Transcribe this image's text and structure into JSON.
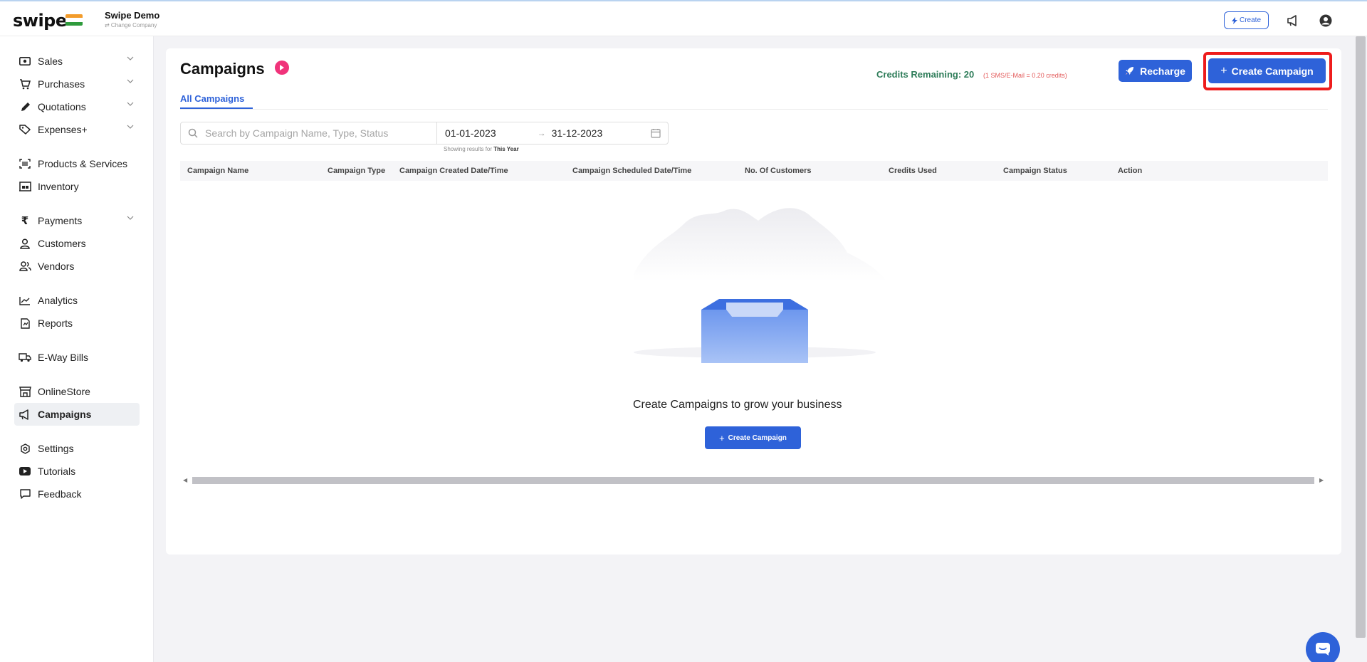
{
  "header": {
    "logo": "swipe",
    "company_name": "Swipe Demo",
    "change_company": "⇄ Change Company",
    "create_label": "Create"
  },
  "sidebar": {
    "items": [
      {
        "label": "Sales",
        "icon": "cash-icon",
        "has_chevron": true
      },
      {
        "label": "Purchases",
        "icon": "cart-icon",
        "has_chevron": true
      },
      {
        "label": "Quotations",
        "icon": "pen-icon",
        "has_chevron": true
      },
      {
        "label": "Expenses+",
        "icon": "tag-icon",
        "has_chevron": true
      },
      {
        "label": "Products & Services",
        "icon": "barcode-icon"
      },
      {
        "label": "Inventory",
        "icon": "warehouse-icon"
      },
      {
        "label": "Payments",
        "icon": "rupee-icon",
        "has_chevron": true
      },
      {
        "label": "Customers",
        "icon": "user-icon"
      },
      {
        "label": "Vendors",
        "icon": "users-icon"
      },
      {
        "label": "Analytics",
        "icon": "chart-line-icon"
      },
      {
        "label": "Reports",
        "icon": "report-icon"
      },
      {
        "label": "E-Way Bills",
        "icon": "truck-icon"
      },
      {
        "label": "OnlineStore",
        "icon": "store-icon"
      },
      {
        "label": "Campaigns",
        "icon": "megaphone-icon",
        "active": true
      },
      {
        "label": "Settings",
        "icon": "settings-icon"
      },
      {
        "label": "Tutorials",
        "icon": "youtube-icon"
      },
      {
        "label": "Feedback",
        "icon": "comment-icon"
      }
    ]
  },
  "main": {
    "title": "Campaigns",
    "tab": "All Campaigns",
    "credits_remaining": "Credits Remaining: 20",
    "credits_note": "(1 SMS/E-Mail = 0.20 credits)",
    "recharge_label": "Recharge",
    "create_campaign_label": "Create Campaign",
    "search_placeholder": "Search by Campaign Name, Type, Status",
    "date_from": "01-01-2023",
    "date_to": "31-12-2023",
    "showing_prefix": "Showing results for",
    "showing_value": "This Year",
    "columns": [
      "Campaign Name",
      "Campaign Type",
      "Campaign Created Date/Time",
      "Campaign Scheduled Date/Time",
      "No. Of Customers",
      "Credits Used",
      "Campaign Status",
      "Action"
    ],
    "empty_text": "Create Campaigns to grow your business",
    "empty_button": "Create Campaign"
  },
  "colors": {
    "accent": "#2e62d9",
    "credits": "#2f7d5a",
    "credits_note": "#e35b5b",
    "highlight": "#ee1c1c",
    "play": "#f0337a"
  }
}
